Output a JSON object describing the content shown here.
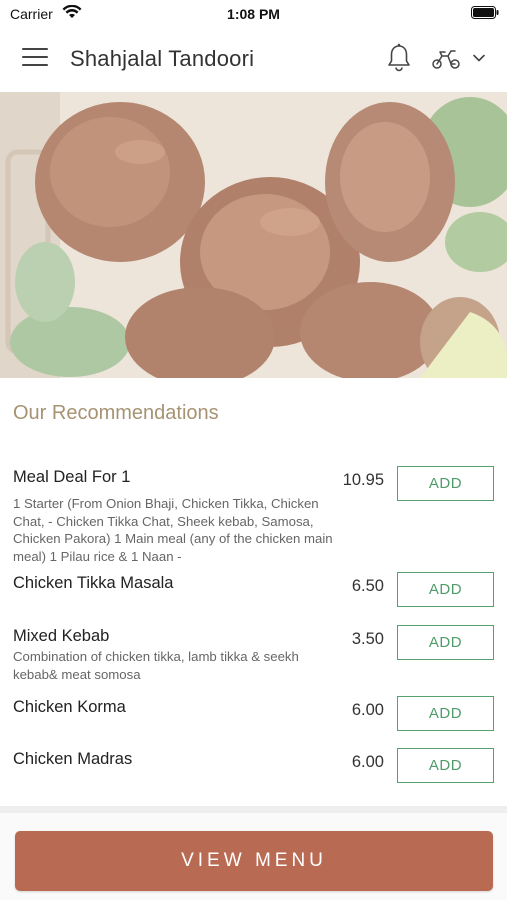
{
  "status_bar": {
    "carrier": "Carrier",
    "time": "1:08 PM"
  },
  "header": {
    "title": "Shahjalal Tandoori",
    "icons": [
      "menu-icon",
      "bell-icon",
      "delivery-icon",
      "chevron-down-icon"
    ]
  },
  "hero": {
    "image": "tandoori-chicken-photo"
  },
  "recommendations": {
    "title": "Our Recommendations",
    "add_label": "ADD",
    "items": [
      {
        "name": "Meal Deal For 1",
        "description": "1 Starter (From Onion Bhaji, Chicken Tikka, Chicken Chat,  - Chicken Tikka Chat, Sheek kebab, Samosa, Chicken Pakora)  1 Main meal (any of the chicken main meal)  1 Pilau rice  & 1 Naan  -",
        "price": "10.95"
      },
      {
        "name": "Chicken Tikka Masala",
        "description": "",
        "price": "6.50"
      },
      {
        "name": "Mixed Kebab",
        "description": "Combination of chicken tikka, lamb tikka & seekh kebab& meat somosa",
        "price": "3.50"
      },
      {
        "name": "Chicken Korma",
        "description": "",
        "price": "6.00"
      },
      {
        "name": "Chicken Madras",
        "description": "",
        "price": "6.00"
      }
    ]
  },
  "footer": {
    "view_menu_label": "VIEW MENU"
  },
  "colors": {
    "accent": "#b96a53",
    "add_green": "#4f9b6a",
    "section_title": "#a79373"
  }
}
